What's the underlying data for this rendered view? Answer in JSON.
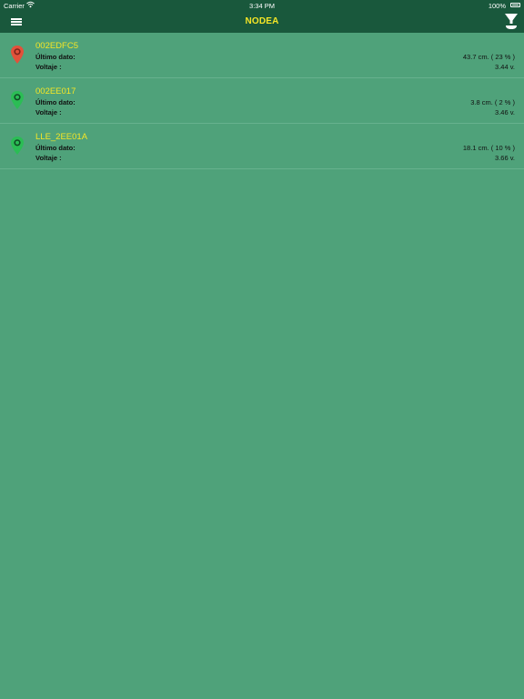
{
  "status_bar": {
    "carrier": "Carrier",
    "time": "3:34 PM",
    "battery": "100%"
  },
  "nav": {
    "title": "NODEA",
    "menu_icon": "hamburger-menu-icon",
    "filter_icon": "funnel-filter-icon"
  },
  "colors": {
    "background": "#4fa27a",
    "bar": "#19583c",
    "accent_yellow": "#f5e626",
    "pin_red": "#e2513a",
    "pin_green": "#2bbd55"
  },
  "devices": [
    {
      "name": "002EDFC5",
      "pin": "red",
      "last_label": "Último dato:",
      "last_value": "43.7 cm. ( 23 % )",
      "voltage_label": "Voltaje :",
      "voltage_value": "3.44 v."
    },
    {
      "name": "002EE017",
      "pin": "green",
      "last_label": "Último dato:",
      "last_value": "3.8 cm. ( 2 % )",
      "voltage_label": "Voltaje :",
      "voltage_value": "3.46 v."
    },
    {
      "name": "LLE_2EE01A",
      "pin": "green",
      "last_label": "Último dato:",
      "last_value": "18.1 cm. ( 10 % )",
      "voltage_label": "Voltaje :",
      "voltage_value": "3.66 v."
    }
  ]
}
